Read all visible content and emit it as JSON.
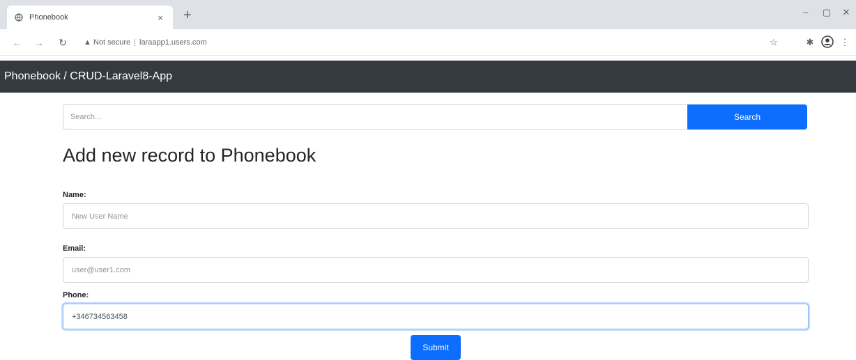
{
  "browser": {
    "tab_title": "Phonebook",
    "tab_close": "×",
    "new_tab": "+",
    "minimize": "–",
    "restore": "▢",
    "close": "✕",
    "back": "←",
    "forward": "→",
    "reload": "↻",
    "security_warning": "▲ Not secure",
    "url": "laraapp1.users.com",
    "star_icon": "☆",
    "extensions_icon": "✱",
    "menu_icon": "⋮"
  },
  "navbar": {
    "brand": "Phonebook / CRUD-Laravel8-App"
  },
  "search": {
    "placeholder": "Search...",
    "value": "",
    "button_label": "Search"
  },
  "form": {
    "heading": "Add new record to Phonebook",
    "fields": [
      {
        "label": "Name:",
        "value": "",
        "placeholder": "New User Name"
      },
      {
        "label": "Email:",
        "value": "",
        "placeholder": "user@user1.com"
      },
      {
        "label": "Phone:",
        "value": "+346734563458",
        "placeholder": ""
      }
    ],
    "submit_label": "Submit"
  },
  "colors": {
    "primary": "#0d6efd",
    "navbar_bg": "#343a40",
    "tabstrip_bg": "#dee1e6"
  }
}
